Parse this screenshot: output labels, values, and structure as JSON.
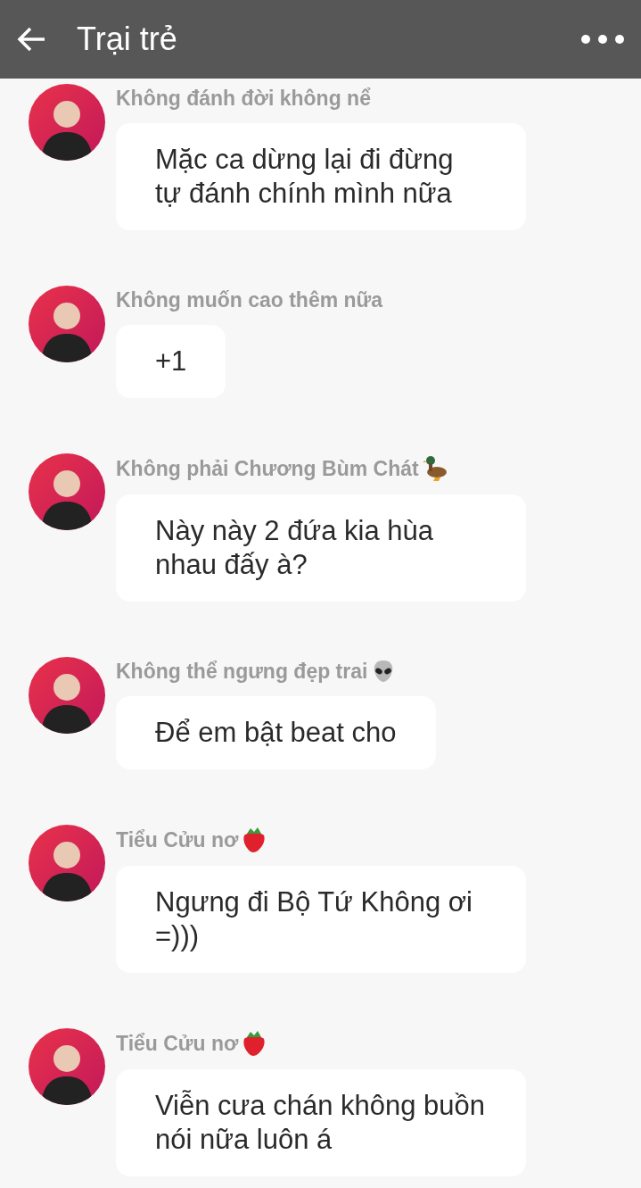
{
  "header": {
    "title": "Trại trẻ"
  },
  "messages": [
    {
      "sender": "Không đánh đời không nể",
      "text": "Mặc ca dừng lại đi đừng tự đánh chính mình nữa"
    },
    {
      "sender": "Không muốn cao thêm nữa",
      "text": "+1"
    },
    {
      "sender": "Không phải Chương Bùm Chát",
      "kind": "duck",
      "text": "Này này 2 đứa kia hùa nhau đấy à?"
    },
    {
      "sender": "Không thể ngưng đẹp trai",
      "kind": "alien",
      "text": "Để em bật beat cho"
    },
    {
      "sender": "Tiểu Cửu nơ",
      "kind": "strawberry",
      "text": "Ngưng đi Bộ Tứ Không ơi =)))"
    },
    {
      "sender": "Tiểu Cửu nơ",
      "kind": "strawberry",
      "text": "Viễn cưa chán không buồn nói nữa luôn á"
    }
  ]
}
